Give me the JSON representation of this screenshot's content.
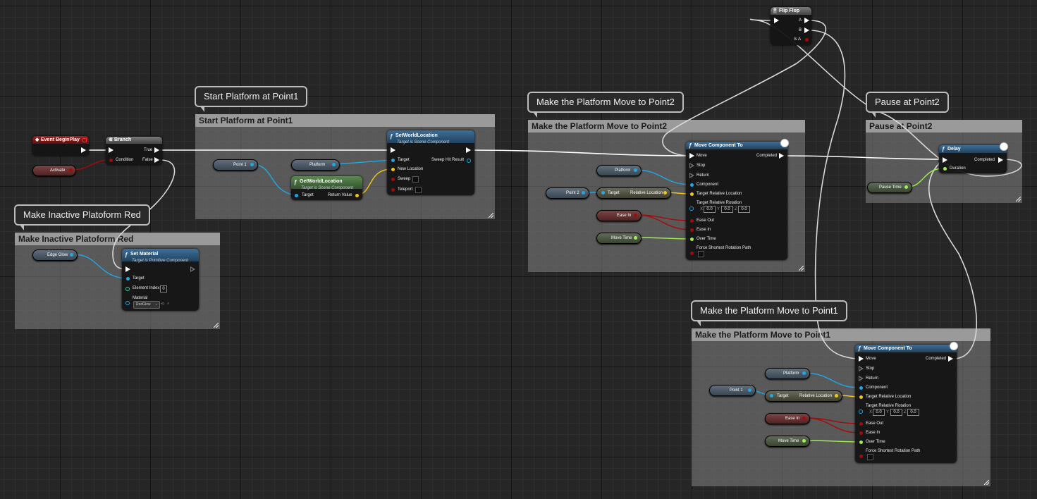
{
  "comments": {
    "start": {
      "title": "Start Platform at Point1",
      "bubble": "Start Platform at Point1"
    },
    "move2": {
      "title": "Make the Platform Move to Point2",
      "bubble": "Make the Platform Move to Point2"
    },
    "pause2": {
      "title": "Pause at Point2",
      "bubble": "Pause at Point2"
    },
    "inactive": {
      "title": "Make Inactive Platoform Red",
      "bubble": "Make Inactive Platoform Red"
    },
    "move1": {
      "title": "Make the Platform Move to Point1",
      "bubble": "Make the Platform Move to Point1"
    }
  },
  "nodes": {
    "event_begin_play": {
      "title": "Event BeginPlay"
    },
    "activate": {
      "label": "Activate"
    },
    "branch": {
      "title": "Branch",
      "pins": {
        "condition": "Condition",
        "true": "True",
        "false": "False"
      }
    },
    "flip_flop": {
      "title": "Flip Flop",
      "pins": {
        "a": "A",
        "b": "B",
        "is_a": "Is A"
      }
    },
    "set_world_location": {
      "title": "SetWorldLocation",
      "subtitle": "Target is Scene Component",
      "pins": {
        "target": "Target",
        "new_location": "New Location",
        "sweep": "Sweep",
        "teleport": "Teleport",
        "sweep_hit": "Sweep Hit Result"
      }
    },
    "get_world_location": {
      "title": "GetWorldLocation",
      "subtitle": "Target is Scene Component",
      "pins": {
        "target": "Target",
        "return": "Return Value"
      }
    },
    "move_to_2": {
      "title": "Move Component To",
      "pins": {
        "move": "Move",
        "stop": "Stop",
        "return": "Return",
        "completed": "Completed",
        "component": "Component",
        "target_loc": "Target Relative Location",
        "target_rot": "Target Relative Rotation",
        "ease_out": "Ease Out",
        "ease_in": "Ease In",
        "over_time": "Over Time",
        "force_shortest": "Force Shortest Rotation Path"
      },
      "rot": {
        "x_label": "X",
        "x": "0.0",
        "y_label": "Y",
        "y": "0.0",
        "z_label": "Z",
        "z": "0.0"
      }
    },
    "move_to_1": {
      "title": "Move Component To",
      "pins": {
        "move": "Move",
        "stop": "Stop",
        "return": "Return",
        "completed": "Completed",
        "component": "Component",
        "target_loc": "Target Relative Location",
        "target_rot": "Target Relative Rotation",
        "ease_out": "Ease Out",
        "ease_in": "Ease In",
        "over_time": "Over Time",
        "force_shortest": "Force Shortest Rotation Path"
      },
      "rot": {
        "x_label": "X",
        "x": "0.0",
        "y_label": "Y",
        "y": "0.0",
        "z_label": "Z",
        "z": "0.0"
      }
    },
    "delay": {
      "title": "Delay",
      "pins": {
        "completed": "Completed",
        "duration": "Duration"
      }
    },
    "set_material": {
      "title": "Set Material",
      "subtitle": "Target is Primitive Component",
      "pins": {
        "target": "Target",
        "element_index": "Element Index",
        "element_index_value": "0",
        "material": "Material"
      },
      "material_value": "RedGlow"
    }
  },
  "variables": {
    "point1_a": "Point 1",
    "platform_a": "Platform",
    "platform_b": "Platform",
    "point2": "Point 2",
    "break_target_label": "Target",
    "break_relloc_label": "Relative Location",
    "ease_in_a": "Ease In",
    "move_time_a": "Move Time",
    "pause_time": "Pause Time",
    "edge_glow": "Edge Glow",
    "platform_c": "Platform",
    "point1_b": "Point 1",
    "ease_in_b": "Ease In",
    "move_time_b": "Move Time"
  },
  "colors": {
    "exec": "#ffffff",
    "object_pin": "#1fa7e8",
    "vector_pin": "#f2c515",
    "float_pin": "#9ff04a",
    "ease_pin": "#a50a0a",
    "function_header": "#3c6f9a",
    "pure_header": "#5c8a52",
    "event_header": "#a42020"
  }
}
